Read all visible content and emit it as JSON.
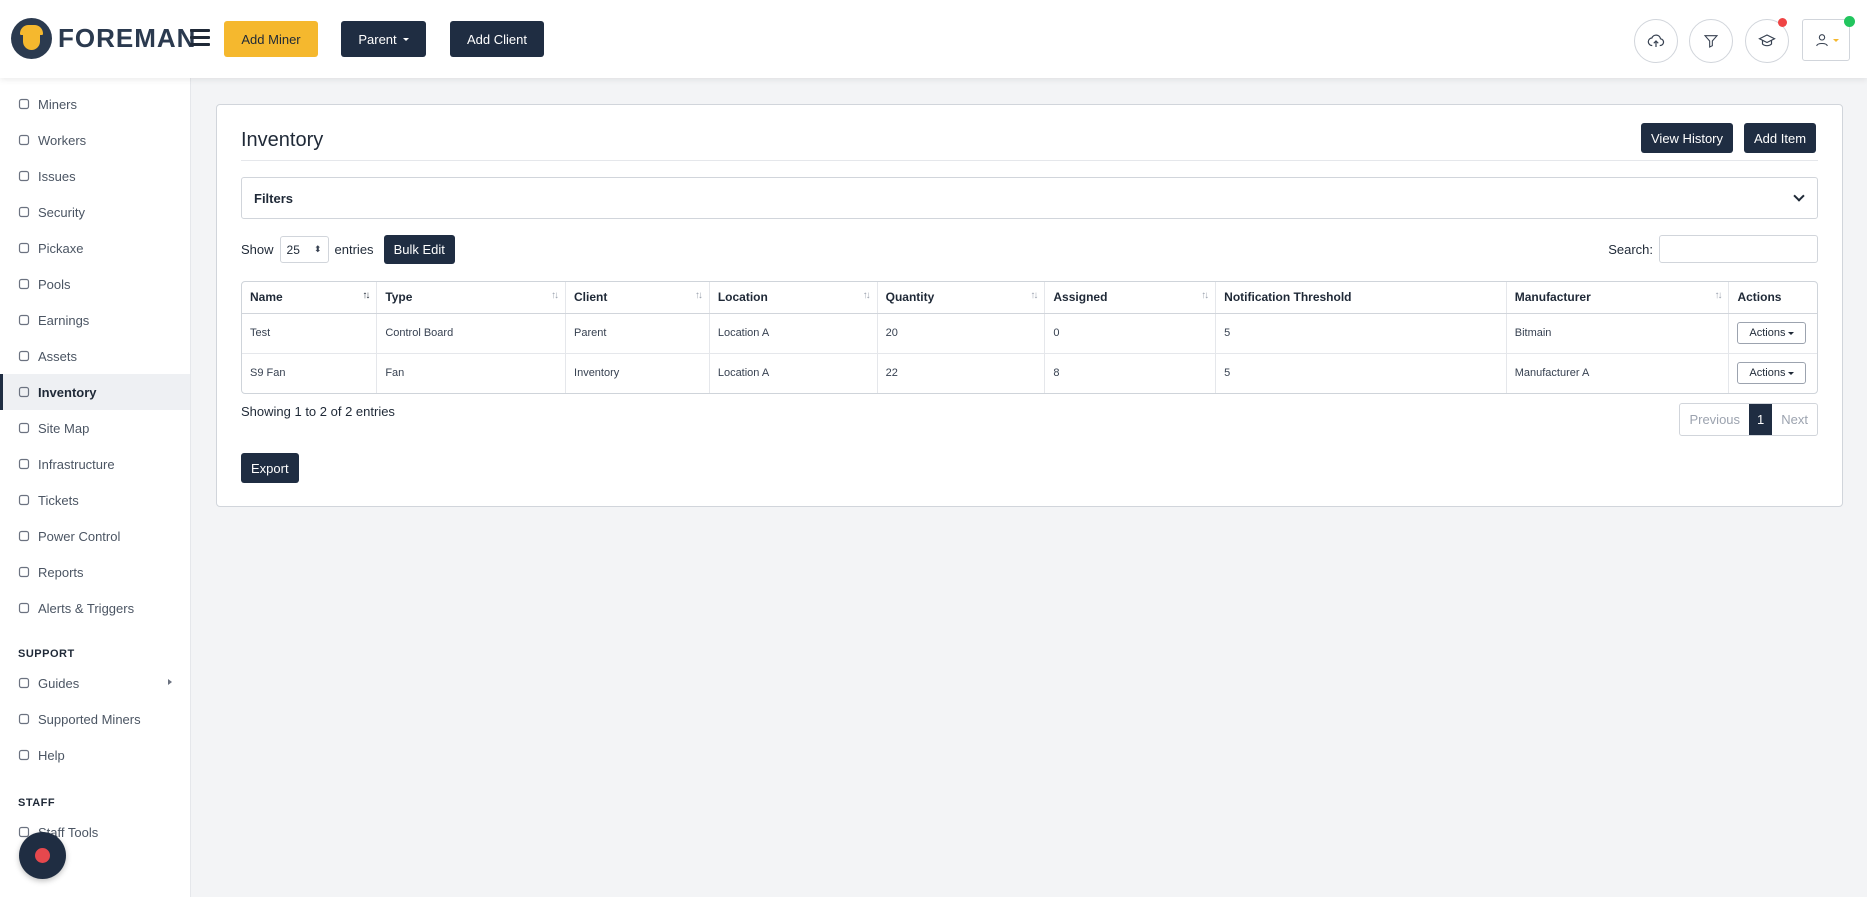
{
  "header": {
    "logo_text": "FOREMAN",
    "add_miner_label": "Add Miner",
    "parent_label": "Parent",
    "add_client_label": "Add Client"
  },
  "sidebar": {
    "items": [
      {
        "label": "Miners",
        "icon": "server-icon"
      },
      {
        "label": "Workers",
        "icon": "hardhat-icon"
      },
      {
        "label": "Issues",
        "icon": "warning-icon"
      },
      {
        "label": "Security",
        "icon": "shield-icon"
      },
      {
        "label": "Pickaxe",
        "icon": "pickaxe-icon"
      },
      {
        "label": "Pools",
        "icon": "pool-icon"
      },
      {
        "label": "Earnings",
        "icon": "earnings-icon"
      },
      {
        "label": "Assets",
        "icon": "assets-icon"
      },
      {
        "label": "Inventory",
        "icon": "inventory-icon"
      },
      {
        "label": "Site Map",
        "icon": "map-icon"
      },
      {
        "label": "Infrastructure",
        "icon": "layers-icon"
      },
      {
        "label": "Tickets",
        "icon": "ticket-icon"
      },
      {
        "label": "Power Control",
        "icon": "bolt-icon"
      },
      {
        "label": "Reports",
        "icon": "report-icon"
      },
      {
        "label": "Alerts & Triggers",
        "icon": "alert-icon"
      }
    ],
    "support_title": "SUPPORT",
    "support_items": [
      {
        "label": "Guides",
        "icon": "book-icon"
      },
      {
        "label": "Supported Miners",
        "icon": "list-icon"
      },
      {
        "label": "Help",
        "icon": "help-icon"
      }
    ],
    "staff_title": "STAFF",
    "staff_items": [
      {
        "label": "Staff Tools",
        "icon": "tools-icon"
      }
    ]
  },
  "page": {
    "title": "Inventory",
    "view_history_label": "View History",
    "add_item_label": "Add Item",
    "filters_label": "Filters",
    "show_label": "Show",
    "page_size": "25",
    "entries_label": "entries",
    "bulk_edit_label": "Bulk Edit",
    "search_label": "Search:",
    "search_value": "",
    "columns": [
      "Name",
      "Type",
      "Client",
      "Location",
      "Quantity",
      "Assigned",
      "Notification Threshold",
      "Manufacturer",
      "Actions"
    ],
    "rows": [
      [
        "Test",
        "Control Board",
        "Parent",
        "Location A",
        "20",
        "0",
        "5",
        "Bitmain"
      ],
      [
        "S9 Fan",
        "Fan",
        "Inventory",
        "Location A",
        "22",
        "8",
        "5",
        "Manufacturer A"
      ]
    ],
    "actions_label": "Actions",
    "showing_text": "Showing 1 to 2 of 2 entries",
    "pager": {
      "previous": "Previous",
      "current": "1",
      "next": "Next"
    },
    "export_label": "Export"
  },
  "colors": {
    "accent_yellow": "#f5b82e",
    "primary_dark": "#1f2d42",
    "notification_red": "#ef4444",
    "status_green": "#22c55e"
  }
}
